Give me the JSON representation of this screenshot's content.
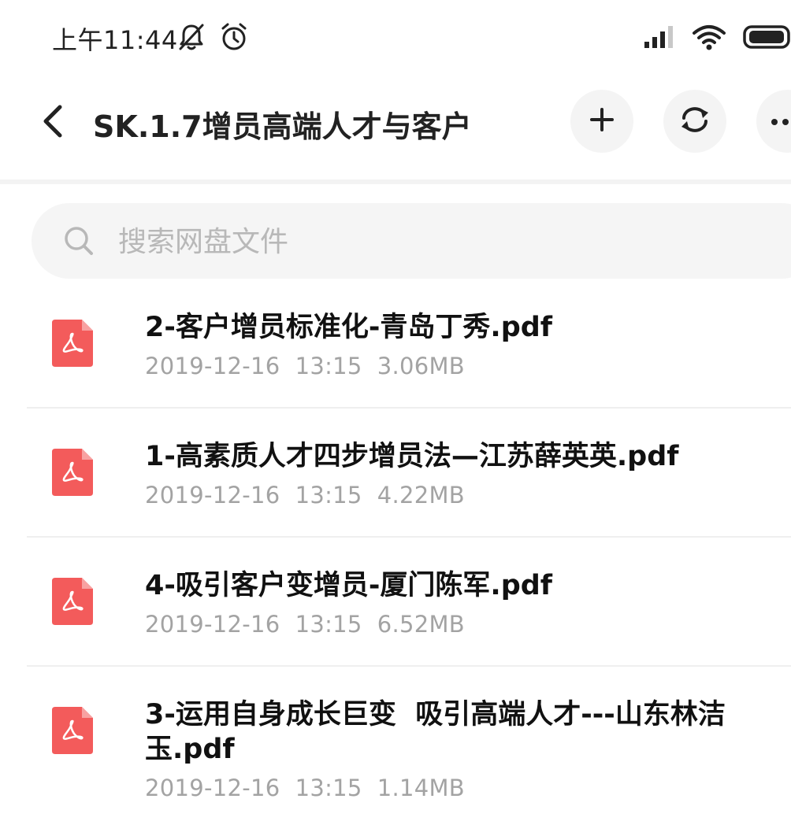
{
  "status_bar": {
    "time": "上午11:44",
    "icons": [
      "bell-off-icon",
      "alarm-clock-icon",
      "signal-icon",
      "wifi-icon",
      "battery-icon"
    ]
  },
  "header": {
    "title": "SK.1.7增员高端人才与客户",
    "icons": [
      "chevron-left-icon",
      "plus-icon",
      "sync-icon",
      "more-icon"
    ]
  },
  "search": {
    "placeholder": "搜索网盘文件",
    "icon": "search-icon"
  },
  "files": [
    {
      "name": "2-客户增员标准化-青岛丁秀.pdf",
      "date": "2019-12-16",
      "time": "13:15",
      "size": "3.06MB",
      "icon": "pdf-file-icon"
    },
    {
      "name": "1-高素质人才四步增员法—江苏薛英英.pdf",
      "date": "2019-12-16",
      "time": "13:15",
      "size": "4.22MB",
      "icon": "pdf-file-icon"
    },
    {
      "name": "4-吸引客户变增员-厦门陈军.pdf",
      "date": "2019-12-16",
      "time": "13:15",
      "size": "6.52MB",
      "icon": "pdf-file-icon"
    },
    {
      "name": "3-运用自身成长巨变  吸引高端人才---山东林洁玉.pdf",
      "date": "2019-12-16",
      "time": "13:15",
      "size": "1.14MB",
      "icon": "pdf-file-icon"
    }
  ],
  "colors": {
    "pdf_red": "#f35b5b",
    "meta_gray": "#a3a3a3",
    "button_bg": "#f4f4f4",
    "search_bg": "#f5f5f5"
  }
}
